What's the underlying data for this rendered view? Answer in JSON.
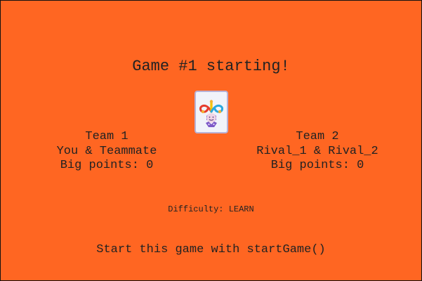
{
  "title": "Game #1 starting!",
  "card": {
    "icon": "jester-icon"
  },
  "teams": [
    {
      "name": "Team 1",
      "players": "You & Teammate",
      "big_points": "Big points: 0"
    },
    {
      "name": "Team 2",
      "players": "Rival_1 & Rival_2",
      "big_points": "Big points: 0"
    }
  ],
  "difficulty": "Difficulty: LEARN",
  "start_hint": "Start this game with startGame()",
  "colors": {
    "background": "#FF6622",
    "text": "#222222",
    "card_background": "#F1F3FA",
    "card_border": "#B8B2D6"
  }
}
